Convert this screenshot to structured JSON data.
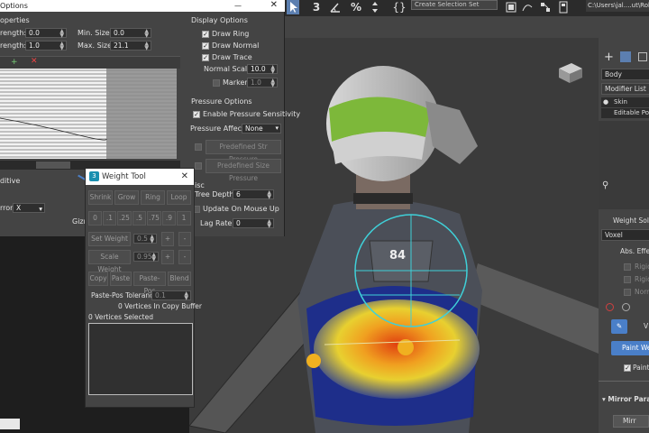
{
  "toolbar": {
    "icons": [
      "select-region-icon",
      "snap-3-icon",
      "angle-snap-icon",
      "percent-snap-icon",
      "spinner-snap-icon",
      "named-selection-icon"
    ],
    "snap_label": "3",
    "percent_label": "%",
    "braces_label": "{}",
    "selection_set_placeholder": "Create Selection Set",
    "path": "C:\\Users\\jal....ut\\Robo"
  },
  "brush_options": {
    "title": "Options",
    "close_label": "✕",
    "properties_heading": "operties",
    "strength_label": "rength:",
    "strength_value": "0.0",
    "strength2_label": "rength:",
    "strength2_value": "1.0",
    "min_size_label": "Min. Size:",
    "min_size_value": "0.0",
    "max_size_label": "Max. Size:",
    "max_size_value": "21.1",
    "curve_close": "✕",
    "additive_label": "ditive",
    "mirror_label": "rror",
    "mirror_value": "X",
    "gizmo_label": "Gizm",
    "display_options_heading": "Display Options",
    "draw_ring_label": "Draw Ring",
    "draw_normal_label": "Draw Normal",
    "draw_trace_label": "Draw Trace",
    "normal_scale_label": "Normal Scale:",
    "normal_scale_value": "10.0",
    "marker_label": "Marker",
    "marker_value": "1.0",
    "pressure_options_heading": "Pressure Options",
    "enable_pressure_label": "Enable Pressure Sensitivity",
    "pressure_affects_label": "Pressure Affects",
    "pressure_affects_value": "None",
    "predefined_str_label": "Predefined Str Pressure",
    "predefined_size_label": "Predefined Size Pressure",
    "misc_heading": "isc",
    "tree_depth_label": "Tree Depth:",
    "tree_depth_value": "6",
    "update_mouse_up_label": "Update On Mouse Up",
    "lag_rate_label": "Lag Rate:",
    "lag_rate_value": "0",
    "checkboxes": {
      "draw_ring": true,
      "draw_normal": true,
      "draw_trace": true,
      "marker": false,
      "enable_pressure": true,
      "update_mouse_up": false
    }
  },
  "weight_tool": {
    "title": "Weight Tool",
    "close_label": "✕",
    "logo_label": "3",
    "row1": [
      "Shrink",
      "Grow",
      "Ring",
      "Loop"
    ],
    "row2": [
      "0",
      ".1",
      ".25",
      ".5",
      ".75",
      ".9",
      "1"
    ],
    "set_weight_label": "Set Weight",
    "set_weight_value": "0.5",
    "scale_weight_label": "Scale Weight",
    "scale_weight_value": "0.95",
    "plus_label": "+",
    "minus_label": "-",
    "row5": [
      "Copy",
      "Paste",
      "Paste-Pos",
      "Blend"
    ],
    "paste_pos_tol_label": "Paste-Pos Tolerance",
    "paste_pos_tol_value": "0.1",
    "copy_buffer_text": "0 Vertices In Copy Buffer",
    "vertices_selected_text": "0 Vertices Selected"
  },
  "command_panel": {
    "object_name": "Body",
    "modifier_list_label": "Modifier List",
    "modifiers": [
      "Skin",
      "Editable Poly"
    ],
    "weight_solver_label": "Weight Solve",
    "voxel_value": "Voxel",
    "abs_effect_label": "Abs. Effec",
    "rigid1_label": "Rigid",
    "rigid2_label": "Rigid",
    "normalize_label": "Norm",
    "v_button_label": "V",
    "paint_weights_label": "Paint Wei",
    "paint_check_label": "Paint",
    "mirror_params_label": "Mirror Para",
    "mirror_button_label": "Mirr"
  },
  "viewport": {
    "badge_text": "84"
  },
  "colors": {
    "panel_bg": "#444444",
    "accent_blue": "#4a7fc8",
    "visor_green": "#7db83a",
    "gizmo_cyan": "#3fd0d8"
  }
}
